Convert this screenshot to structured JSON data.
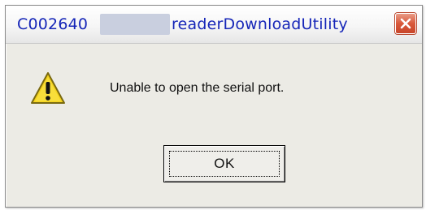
{
  "window": {
    "title_prefix": "C002640",
    "title_app": "readerDownloadUtility",
    "close_icon": "close-icon"
  },
  "content": {
    "icon": "warning-icon",
    "message": "Unable to open the serial port."
  },
  "buttons": {
    "ok_label": "OK"
  },
  "colors": {
    "title_text": "#1626b8",
    "dialog_bg": "#ecebe5",
    "close_button": "#d9593b",
    "warning_yellow": "#f4d21c"
  }
}
